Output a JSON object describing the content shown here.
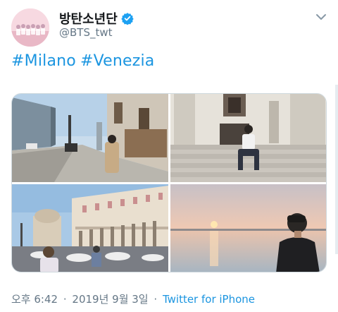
{
  "user": {
    "display_name": "방탄소년단",
    "handle": "@BTS_twt",
    "verified": true,
    "verified_color": "#1da1f2"
  },
  "menu": {
    "icon": "chevron-down-icon"
  },
  "tweet": {
    "hashtags": [
      "#Milano",
      "#Venezia"
    ],
    "link_color": "#1b95e0"
  },
  "media": [
    {
      "name": "milan-street-photo"
    },
    {
      "name": "venice-church-steps-photo"
    },
    {
      "name": "doges-palace-photo"
    },
    {
      "name": "venice-sunset-photo"
    }
  ],
  "meta": {
    "time": "오후 6:42",
    "separator": "·",
    "date": "2019년 9월 3일",
    "source": "Twitter for iPhone"
  }
}
